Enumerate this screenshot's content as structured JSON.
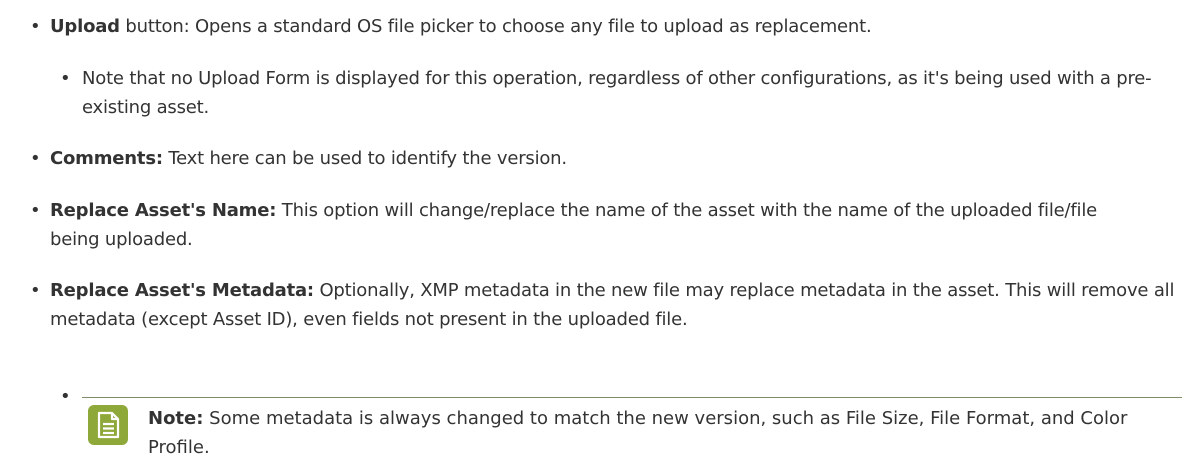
{
  "items": [
    {
      "bold": "Upload",
      "rest": " button: Opens a standard OS file picker to choose any file to upload as replacement."
    },
    {
      "sub": "Note that no Upload Form is displayed for this operation, regardless of other configurations, as it's being used with a pre-existing asset."
    },
    {
      "bold": "Comments:",
      "rest": " Text here can be used to identify the version."
    },
    {
      "bold": "Replace Asset's Name:",
      "rest": " This option will change/replace the name of the asset with the name of the uploaded file/file being uploaded."
    },
    {
      "bold": "Replace Asset's Metadata:",
      "rest": " Optionally, XMP metadata in the new file may replace metadata in the asset. This will remove all metadata (except Asset ID), even fields not present in the uploaded file."
    }
  ],
  "note": {
    "label": "Note:",
    "text": "  Some metadata is always changed to match the new version, such as File Size, File Format, and Color Profile."
  },
  "bullet_char": "•",
  "colors": {
    "icon_bg": "#8fa83a",
    "text": "#333333"
  }
}
